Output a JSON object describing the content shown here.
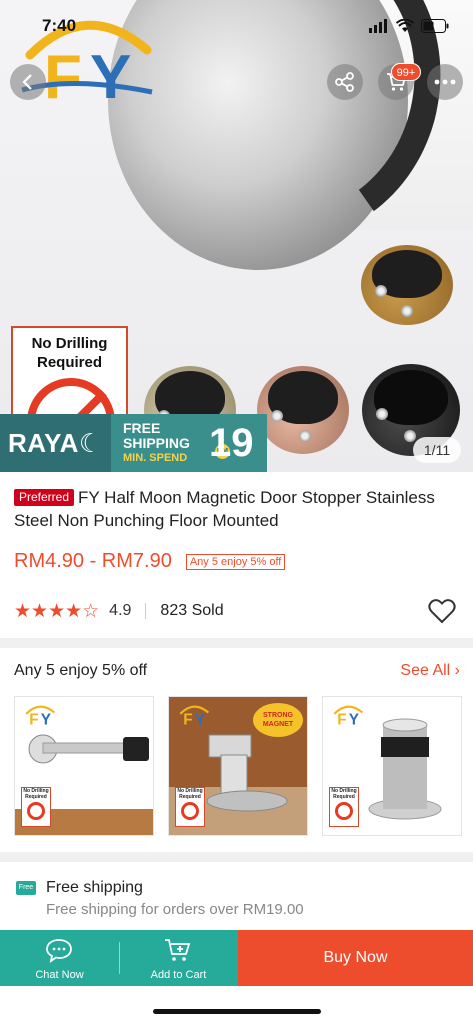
{
  "status_bar": {
    "time": "7:40"
  },
  "product_image": {
    "banner_raya": "RAYA",
    "banner_line1": "FREE",
    "banner_line2": "SHIPPING",
    "banner_line3": "MIN. SPEND",
    "banner_currency": "RM",
    "banner_amount": "19",
    "no_drilling_text": "No Drilling Required",
    "counter": "1/11"
  },
  "header": {
    "cart_badge": "99+",
    "icons": [
      "back-icon",
      "share-icon",
      "cart-icon",
      "more-icon"
    ]
  },
  "product": {
    "badge": "Preferred",
    "title": "FY Half Moon Magnetic Door Stopper Stainless Steel Non Punching Floor Mounted",
    "price": "RM4.90 - RM7.90",
    "promo_tag": "Any 5 enjoy 5% off",
    "rating": "4.9",
    "rating_stars": 4.9,
    "sold": "823 Sold"
  },
  "bundle": {
    "title": "Any 5 enjoy 5% off",
    "see_all": "See All",
    "items": [
      {
        "label": "No Drilling Required"
      },
      {
        "label": "No Drilling Required",
        "sticker_line1": "STRONG",
        "sticker_line2": "MAGNET"
      },
      {
        "label": "No Drilling Required"
      }
    ]
  },
  "shipping": {
    "icon_text": "Free",
    "title": "Free shipping",
    "subtitle": "Free shipping for orders over RM19.00"
  },
  "bottom_bar": {
    "chat": "Chat Now",
    "add_to_cart": "Add to Cart",
    "buy_now": "Buy Now"
  },
  "colors": {
    "brand_orange": "#ee4d2d",
    "teal": "#26aa99",
    "preferred_red": "#d0011b"
  }
}
